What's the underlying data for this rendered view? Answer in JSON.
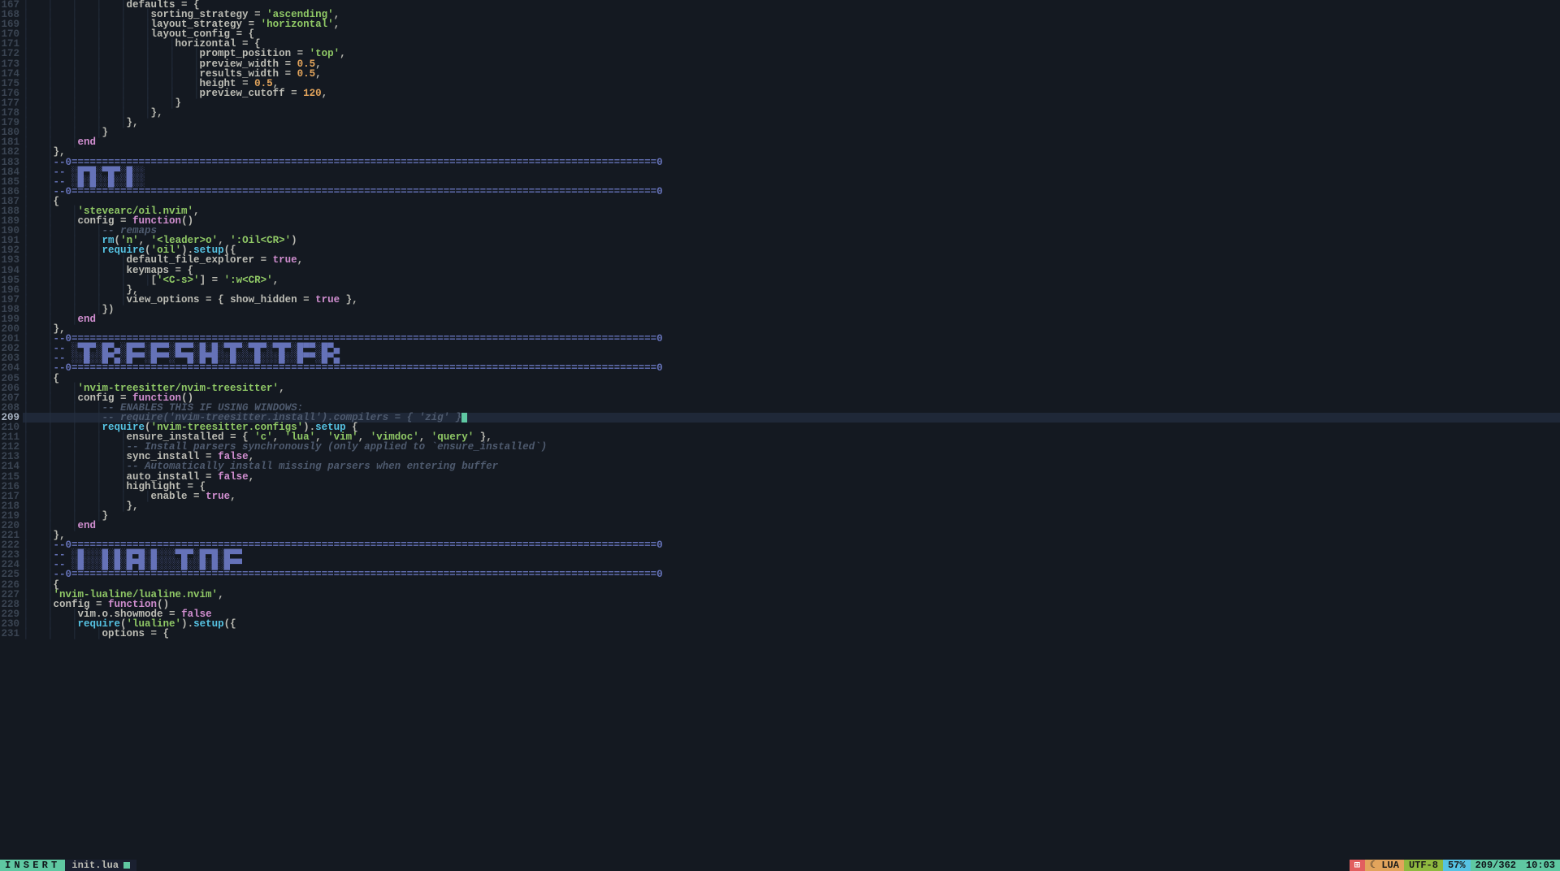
{
  "editor": {
    "first_line": 167,
    "cursor_line": 209,
    "lines": [
      {
        "n": 167,
        "ind": 5,
        "seg": [
          [
            "id",
            "defaults"
          ],
          [
            "punc",
            " = "
          ],
          [
            "brace",
            "{"
          ]
        ]
      },
      {
        "n": 168,
        "ind": 6,
        "seg": [
          [
            "id",
            "sorting_strategy"
          ],
          [
            "punc",
            " = "
          ],
          [
            "str",
            "'ascending'"
          ],
          [
            "punc",
            ","
          ]
        ]
      },
      {
        "n": 169,
        "ind": 6,
        "seg": [
          [
            "id",
            "layout_strategy"
          ],
          [
            "punc",
            " = "
          ],
          [
            "str",
            "'horizontal'"
          ],
          [
            "punc",
            ","
          ]
        ]
      },
      {
        "n": 170,
        "ind": 6,
        "seg": [
          [
            "id",
            "layout_config"
          ],
          [
            "punc",
            " = "
          ],
          [
            "brace",
            "{"
          ]
        ]
      },
      {
        "n": 171,
        "ind": 7,
        "seg": [
          [
            "id",
            "horizontal"
          ],
          [
            "punc",
            " = "
          ],
          [
            "brace",
            "{"
          ]
        ]
      },
      {
        "n": 172,
        "ind": 8,
        "seg": [
          [
            "id",
            "prompt_position"
          ],
          [
            "punc",
            " = "
          ],
          [
            "str",
            "'top'"
          ],
          [
            "punc",
            ","
          ]
        ]
      },
      {
        "n": 173,
        "ind": 8,
        "seg": [
          [
            "id",
            "preview_width"
          ],
          [
            "punc",
            " = "
          ],
          [
            "num",
            "0.5"
          ],
          [
            "punc",
            ","
          ]
        ]
      },
      {
        "n": 174,
        "ind": 8,
        "seg": [
          [
            "id",
            "results_width"
          ],
          [
            "punc",
            " = "
          ],
          [
            "num",
            "0.5"
          ],
          [
            "punc",
            ","
          ]
        ]
      },
      {
        "n": 175,
        "ind": 8,
        "seg": [
          [
            "id",
            "height"
          ],
          [
            "punc",
            " = "
          ],
          [
            "num",
            "0.5"
          ],
          [
            "punc",
            ","
          ]
        ]
      },
      {
        "n": 176,
        "ind": 8,
        "seg": [
          [
            "id",
            "preview_cutoff"
          ],
          [
            "punc",
            " = "
          ],
          [
            "num",
            "120"
          ],
          [
            "punc",
            ","
          ]
        ]
      },
      {
        "n": 177,
        "ind": 7,
        "seg": [
          [
            "brace",
            "}"
          ]
        ]
      },
      {
        "n": 178,
        "ind": 6,
        "seg": [
          [
            "brace",
            "}"
          ],
          [
            "punc",
            ","
          ]
        ]
      },
      {
        "n": 179,
        "ind": 5,
        "seg": [
          [
            "brace",
            "}"
          ],
          [
            "punc",
            ","
          ]
        ]
      },
      {
        "n": 180,
        "ind": 4,
        "seg": [
          [
            "brace",
            "}"
          ]
        ]
      },
      {
        "n": 181,
        "ind": 3,
        "seg": [
          [
            "kw",
            "end"
          ]
        ]
      },
      {
        "n": 182,
        "ind": 2,
        "seg": [
          [
            "brace",
            "}"
          ],
          [
            "punc",
            ","
          ]
        ]
      },
      {
        "n": 183,
        "ind": 2,
        "seg": [
          [
            "banner-sep",
            "--0================================================================================================0"
          ]
        ]
      },
      {
        "n": 184,
        "ind": 2,
        "seg": [
          [
            "banner-art",
            "-- ░█▀█░▀█▀░█░░"
          ]
        ]
      },
      {
        "n": 185,
        "ind": 2,
        "seg": [
          [
            "banner-art",
            "-- ░█░█░░█░░█░░"
          ]
        ]
      },
      {
        "n": 186,
        "ind": 2,
        "seg": [
          [
            "banner-sep",
            "--0================================================================================================0"
          ]
        ]
      },
      {
        "n": 187,
        "ind": 2,
        "seg": [
          [
            "brace",
            "{"
          ]
        ]
      },
      {
        "n": 188,
        "ind": 3,
        "seg": [
          [
            "str",
            "'stevearc/oil.nvim'"
          ],
          [
            "punc",
            ","
          ]
        ]
      },
      {
        "n": 189,
        "ind": 3,
        "seg": [
          [
            "id",
            "config"
          ],
          [
            "punc",
            " = "
          ],
          [
            "kw",
            "function"
          ],
          [
            "punc",
            "()"
          ]
        ]
      },
      {
        "n": 190,
        "ind": 4,
        "seg": [
          [
            "cmt",
            "-- remaps"
          ]
        ]
      },
      {
        "n": 191,
        "ind": 4,
        "seg": [
          [
            "fn",
            "rm"
          ],
          [
            "punc",
            "("
          ],
          [
            "str",
            "'n'"
          ],
          [
            "punc",
            ", "
          ],
          [
            "str",
            "'<leader>o'"
          ],
          [
            "punc",
            ", "
          ],
          [
            "str",
            "':Oil<CR>'"
          ],
          [
            "punc",
            ")"
          ]
        ]
      },
      {
        "n": 192,
        "ind": 4,
        "seg": [
          [
            "fn",
            "require"
          ],
          [
            "punc",
            "("
          ],
          [
            "str",
            "'oil'"
          ],
          [
            "punc",
            ")."
          ],
          [
            "fn",
            "setup"
          ],
          [
            "punc",
            "({"
          ]
        ]
      },
      {
        "n": 193,
        "ind": 5,
        "seg": [
          [
            "id",
            "default_file_explorer"
          ],
          [
            "punc",
            " = "
          ],
          [
            "bool",
            "true"
          ],
          [
            "punc",
            ","
          ]
        ]
      },
      {
        "n": 194,
        "ind": 5,
        "seg": [
          [
            "id",
            "keymaps"
          ],
          [
            "punc",
            " = "
          ],
          [
            "brace",
            "{"
          ]
        ]
      },
      {
        "n": 195,
        "ind": 6,
        "seg": [
          [
            "punc",
            "["
          ],
          [
            "str",
            "'<C-s>'"
          ],
          [
            "punc",
            "] = "
          ],
          [
            "str",
            "':w<CR>'"
          ],
          [
            "punc",
            ","
          ]
        ]
      },
      {
        "n": 196,
        "ind": 5,
        "seg": [
          [
            "brace",
            "}"
          ],
          [
            "punc",
            ","
          ]
        ]
      },
      {
        "n": 197,
        "ind": 5,
        "seg": [
          [
            "id",
            "view_options"
          ],
          [
            "punc",
            " = "
          ],
          [
            "brace",
            "{ "
          ],
          [
            "id",
            "show_hidden"
          ],
          [
            "punc",
            " = "
          ],
          [
            "bool",
            "true"
          ],
          [
            "brace",
            " }"
          ],
          [
            "punc",
            ","
          ]
        ]
      },
      {
        "n": 198,
        "ind": 4,
        "seg": [
          [
            "punc",
            "})"
          ]
        ]
      },
      {
        "n": 199,
        "ind": 3,
        "seg": [
          [
            "kw",
            "end"
          ]
        ]
      },
      {
        "n": 200,
        "ind": 2,
        "seg": [
          [
            "brace",
            "}"
          ],
          [
            "punc",
            ","
          ]
        ]
      },
      {
        "n": 201,
        "ind": 2,
        "seg": [
          [
            "banner-sep",
            "--0================================================================================================0"
          ]
        ]
      },
      {
        "n": 202,
        "ind": 2,
        "seg": [
          [
            "banner-art",
            "-- ░▀█▀░█▀▄░█▀▀░█▀▀░█▀▀░█░█░▀█▀░▀█▀░▀█▀░█▀▀░█▀▄"
          ]
        ]
      },
      {
        "n": 203,
        "ind": 2,
        "seg": [
          [
            "banner-art",
            "-- ░░█░░█▀▄░█▀▀░█▀▀░▀▀█░█▀█░░█░░░█░░░█░░█▀▀░█▀▄"
          ]
        ]
      },
      {
        "n": 204,
        "ind": 2,
        "seg": [
          [
            "banner-sep",
            "--0================================================================================================0"
          ]
        ]
      },
      {
        "n": 205,
        "ind": 2,
        "seg": [
          [
            "brace",
            "{"
          ]
        ]
      },
      {
        "n": 206,
        "ind": 3,
        "seg": [
          [
            "str",
            "'nvim-treesitter/nvim-treesitter'"
          ],
          [
            "punc",
            ","
          ]
        ]
      },
      {
        "n": 207,
        "ind": 3,
        "seg": [
          [
            "id",
            "config"
          ],
          [
            "punc",
            " = "
          ],
          [
            "kw",
            "function"
          ],
          [
            "punc",
            "()"
          ]
        ]
      },
      {
        "n": 208,
        "ind": 4,
        "seg": [
          [
            "cmt",
            "-- ENABLES THIS IF USING WINDOWS:"
          ]
        ]
      },
      {
        "n": 209,
        "ind": 4,
        "seg": [
          [
            "cmt",
            "-- require('nvim-treesitter.install').compilers = { 'zig' }"
          ]
        ],
        "cursor_after": true
      },
      {
        "n": 210,
        "ind": 4,
        "seg": [
          [
            "fn",
            "require"
          ],
          [
            "punc",
            "("
          ],
          [
            "str",
            "'nvim-treesitter.configs'"
          ],
          [
            "punc",
            ")."
          ],
          [
            "fn",
            "setup"
          ],
          [
            "punc",
            " "
          ],
          [
            "brace",
            "{"
          ]
        ]
      },
      {
        "n": 211,
        "ind": 5,
        "seg": [
          [
            "id",
            "ensure_installed"
          ],
          [
            "punc",
            " = "
          ],
          [
            "brace",
            "{ "
          ],
          [
            "str",
            "'c'"
          ],
          [
            "punc",
            ", "
          ],
          [
            "str",
            "'lua'"
          ],
          [
            "punc",
            ", "
          ],
          [
            "str",
            "'vim'"
          ],
          [
            "punc",
            ", "
          ],
          [
            "str",
            "'vimdoc'"
          ],
          [
            "punc",
            ", "
          ],
          [
            "str",
            "'query'"
          ],
          [
            "brace",
            " }"
          ],
          [
            "punc",
            ","
          ]
        ]
      },
      {
        "n": 212,
        "ind": 5,
        "seg": [
          [
            "cmt",
            "-- Install parsers synchronously (only applied to `ensure_installed`)"
          ]
        ]
      },
      {
        "n": 213,
        "ind": 5,
        "seg": [
          [
            "id",
            "sync_install"
          ],
          [
            "punc",
            " = "
          ],
          [
            "bool",
            "false"
          ],
          [
            "punc",
            ","
          ]
        ]
      },
      {
        "n": 214,
        "ind": 5,
        "seg": [
          [
            "cmt",
            "-- Automatically install missing parsers when entering buffer"
          ]
        ]
      },
      {
        "n": 215,
        "ind": 5,
        "seg": [
          [
            "id",
            "auto_install"
          ],
          [
            "punc",
            " = "
          ],
          [
            "bool",
            "false"
          ],
          [
            "punc",
            ","
          ]
        ]
      },
      {
        "n": 216,
        "ind": 5,
        "seg": [
          [
            "id",
            "highlight"
          ],
          [
            "punc",
            " = "
          ],
          [
            "brace",
            "{"
          ]
        ]
      },
      {
        "n": 217,
        "ind": 6,
        "seg": [
          [
            "id",
            "enable"
          ],
          [
            "punc",
            " = "
          ],
          [
            "bool",
            "true"
          ],
          [
            "punc",
            ","
          ]
        ]
      },
      {
        "n": 218,
        "ind": 5,
        "seg": [
          [
            "brace",
            "}"
          ],
          [
            "punc",
            ","
          ]
        ]
      },
      {
        "n": 219,
        "ind": 4,
        "seg": [
          [
            "brace",
            "}"
          ]
        ]
      },
      {
        "n": 220,
        "ind": 3,
        "seg": [
          [
            "kw",
            "end"
          ]
        ]
      },
      {
        "n": 221,
        "ind": 2,
        "seg": [
          [
            "brace",
            "}"
          ],
          [
            "punc",
            ","
          ]
        ]
      },
      {
        "n": 222,
        "ind": 2,
        "seg": [
          [
            "banner-sep",
            "--0================================================================================================0"
          ]
        ]
      },
      {
        "n": 223,
        "ind": 2,
        "seg": [
          [
            "banner-art",
            "-- ░█░░░█░█░█▀█░█░░░▀█▀░█▀█░█▀▀"
          ]
        ]
      },
      {
        "n": 224,
        "ind": 2,
        "seg": [
          [
            "banner-art",
            "-- ░█░░░█░█░█▀█░█░░░░█░░█░█░█▀▀"
          ]
        ]
      },
      {
        "n": 225,
        "ind": 2,
        "seg": [
          [
            "banner-sep",
            "--0================================================================================================0"
          ]
        ]
      },
      {
        "n": 226,
        "ind": 2,
        "seg": [
          [
            "brace",
            "{"
          ]
        ]
      },
      {
        "n": 227,
        "ind": 2,
        "seg": [
          [
            "str",
            "'nvim-lualine/lualine.nvim'"
          ],
          [
            "punc",
            ","
          ]
        ]
      },
      {
        "n": 228,
        "ind": 2,
        "seg": [
          [
            "id",
            "config"
          ],
          [
            "punc",
            " = "
          ],
          [
            "kw",
            "function"
          ],
          [
            "punc",
            "()"
          ]
        ]
      },
      {
        "n": 229,
        "ind": 3,
        "seg": [
          [
            "id",
            "vim.o.showmode"
          ],
          [
            "punc",
            " = "
          ],
          [
            "bool",
            "false"
          ]
        ]
      },
      {
        "n": 230,
        "ind": 3,
        "seg": [
          [
            "fn",
            "require"
          ],
          [
            "punc",
            "("
          ],
          [
            "str",
            "'lualine'"
          ],
          [
            "punc",
            ")."
          ],
          [
            "fn",
            "setup"
          ],
          [
            "punc",
            "({"
          ]
        ]
      },
      {
        "n": 231,
        "ind": 4,
        "seg": [
          [
            "id",
            "options"
          ],
          [
            "punc",
            " = "
          ],
          [
            "brace",
            "{"
          ]
        ]
      }
    ]
  },
  "statusline": {
    "mode": "INSERT",
    "filename": "init.lua",
    "modified": true,
    "os_icon": "⊞",
    "lang_icon": "☾",
    "lang": "LUA",
    "encoding": "UTF-8",
    "percent": "57%",
    "position": "209/362",
    "time": "10:03"
  }
}
